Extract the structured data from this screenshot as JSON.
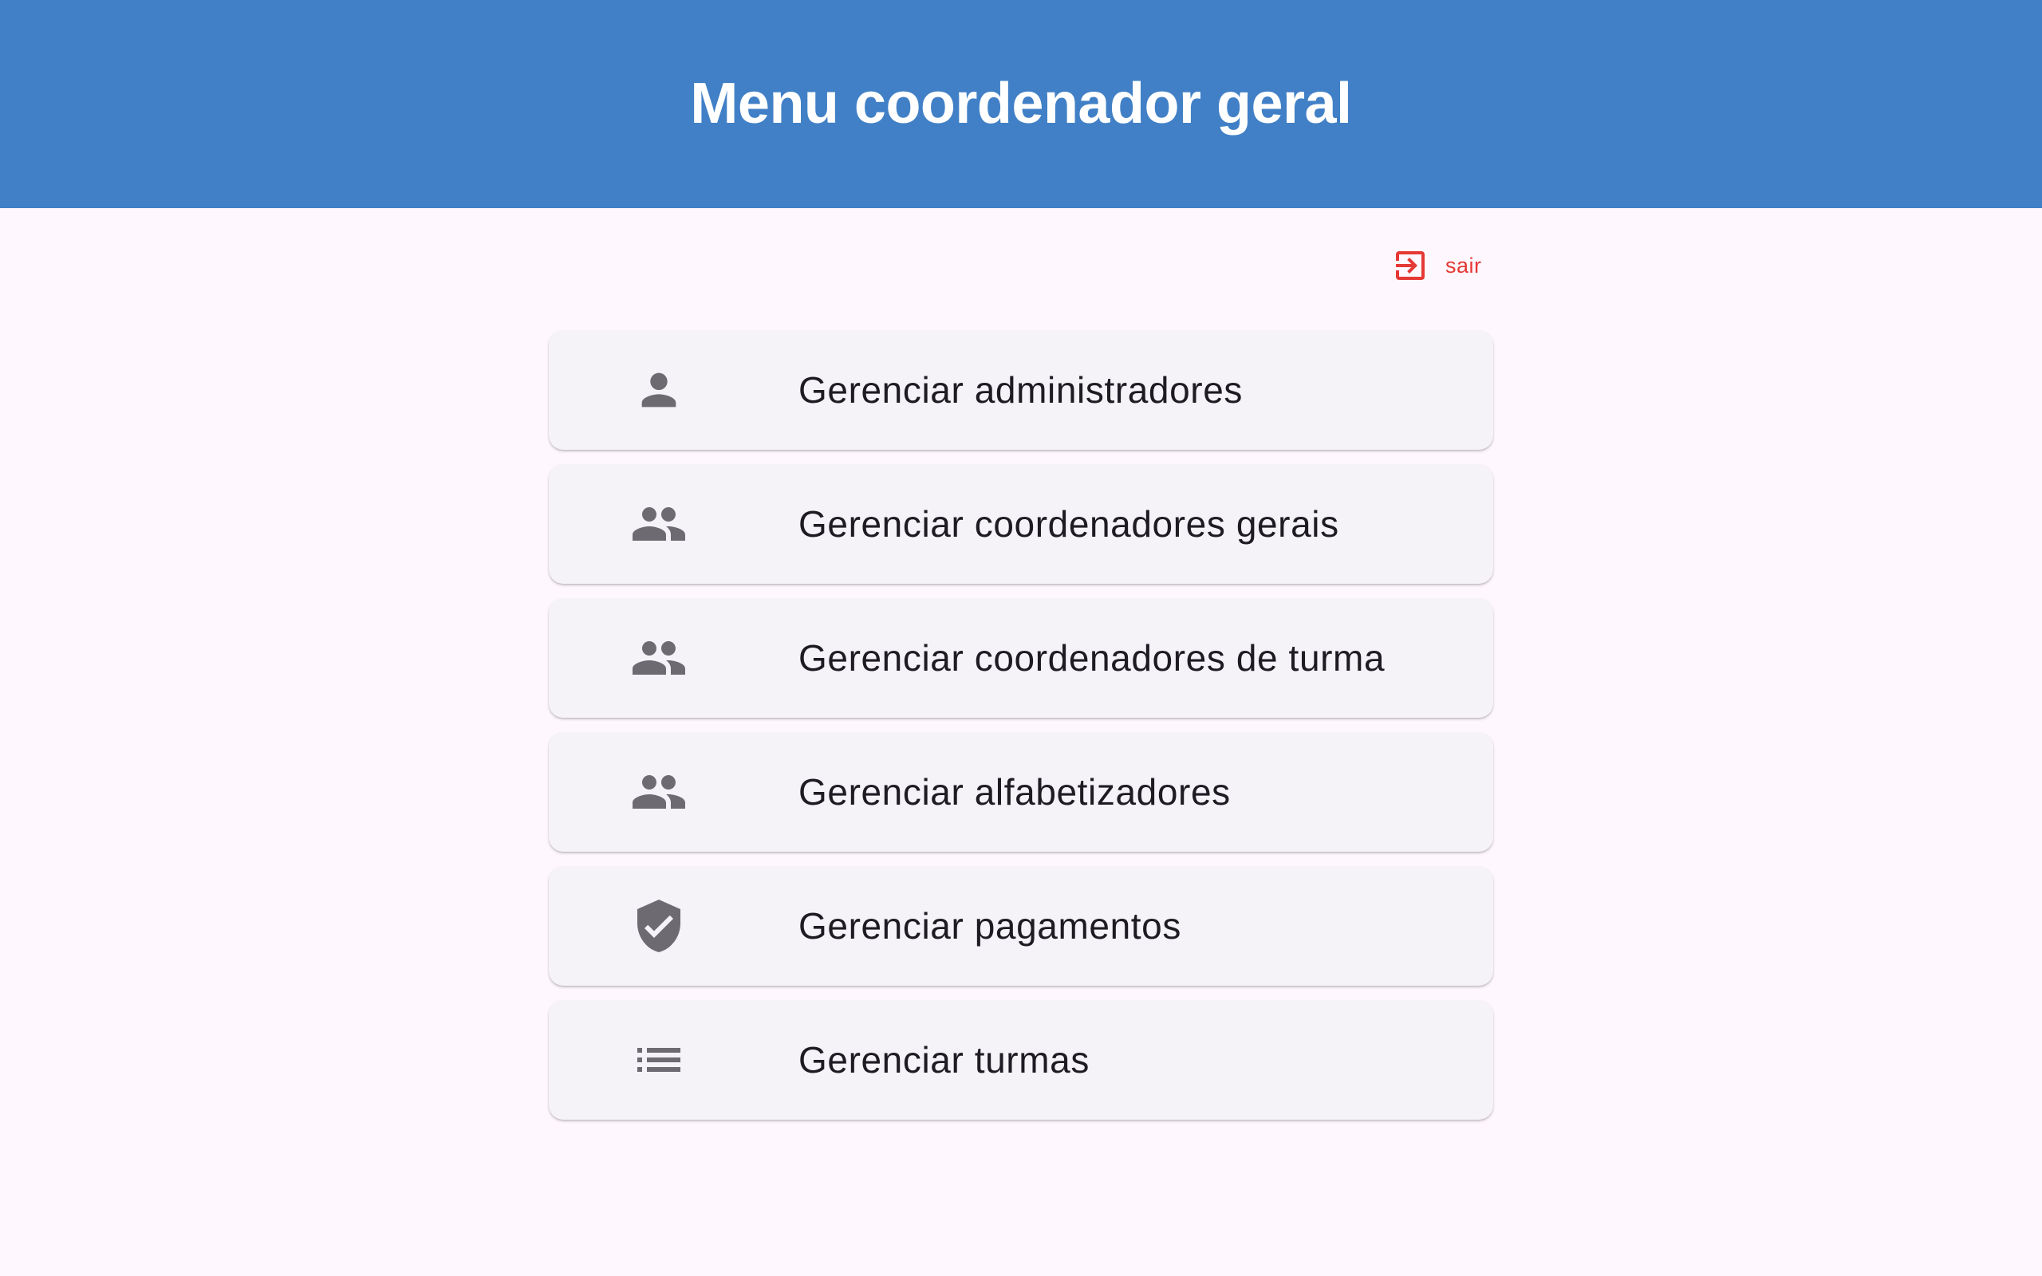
{
  "header": {
    "title": "Menu coordenador geral"
  },
  "logout": {
    "label": "sair",
    "icon": "logout-icon",
    "color": "#e53935"
  },
  "theme": {
    "app_bar": "#4180c6",
    "background": "#fef7fd",
    "card": "#f5f2f8",
    "icon": "#6d6a72"
  },
  "menu": {
    "items": [
      {
        "label": "Gerenciar administradores",
        "icon": "person-icon"
      },
      {
        "label": "Gerenciar coordenadores gerais",
        "icon": "people-icon"
      },
      {
        "label": "Gerenciar coordenadores de turma",
        "icon": "people-icon"
      },
      {
        "label": "Gerenciar alfabetizadores",
        "icon": "people-icon"
      },
      {
        "label": "Gerenciar pagamentos",
        "icon": "verified-shield-icon"
      },
      {
        "label": "Gerenciar turmas",
        "icon": "list-icon"
      }
    ]
  }
}
